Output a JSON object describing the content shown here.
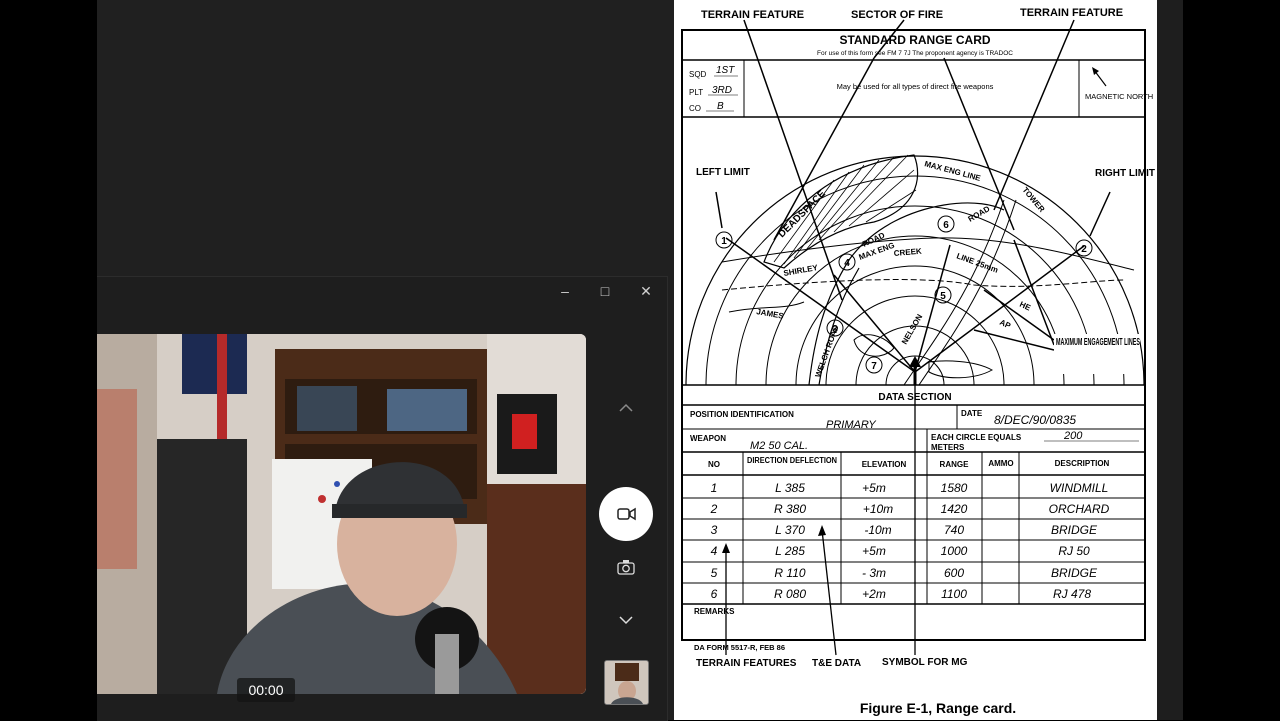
{
  "camera_app": {
    "timer": "00:00",
    "controls": {
      "up_icon": "chevron-up-icon",
      "down_icon": "chevron-down-icon",
      "video_icon": "video-camera-icon",
      "photo_icon": "camera-icon"
    }
  },
  "doc": {
    "top_labels": {
      "left": "TERRAIN FEATURE",
      "center": "SECTOR OF FIRE",
      "right": "TERRAIN FEATURE"
    },
    "title": "STANDARD RANGE CARD",
    "subtitle": "For use of this form see FM 7 7J  The proponent agency is TRADOC",
    "unit_labels": {
      "sqd": "SQD",
      "plt": "PLT",
      "co": "CO"
    },
    "unit_values": {
      "sqd": "1ST",
      "plt": "3RD",
      "co": "B"
    },
    "weapons_note": "May be used for all types of direct fire weapons",
    "north": "MAGNETIC NORTH",
    "left_limit": "LEFT LIMIT",
    "right_limit": "RIGHT LIMIT",
    "max_engagement": "MAXIMUM ENGAGEMENT LINES",
    "sketch": {
      "deadspace": "DEADSPACE",
      "max_eng_line": "MAX ENG LINE",
      "road": "ROAD",
      "max_eng": "MAX ENG",
      "shirley": "SHIRLEY",
      "line_25mm": "LINE 25mm",
      "creek": "CREEK",
      "james": "JAMES",
      "nelson": "NELSON",
      "welch_road": "WELCH ROAD",
      "he": "HE",
      "ap": "AP",
      "tower": "TOWER"
    },
    "data_section_title": "DATA SECTION",
    "position_label": "POSITION IDENTIFICATION",
    "position_value": "PRIMARY",
    "date_label": "DATE",
    "date_value": "8/DEC/90/0835",
    "weapon_label": "WEAPON",
    "weapon_value": "M2 50 CAL.",
    "circle_label": "EACH CIRCLE EQUALS",
    "circle_unit": "METERS",
    "circle_value": "200",
    "table_headers": [
      "NO",
      "DIRECTION DEFLECTION",
      "ELEVATION",
      "RANGE",
      "AMMO",
      "DESCRIPTION"
    ],
    "rows": [
      {
        "no": "1",
        "dir": "L 385",
        "elev": "+5m",
        "range": "1580",
        "desc": "WINDMILL"
      },
      {
        "no": "2",
        "dir": "R 380",
        "elev": "+10m",
        "range": "1420",
        "desc": "ORCHARD"
      },
      {
        "no": "3",
        "dir": "L 370",
        "elev": "-10m",
        "range": "740",
        "desc": "BRIDGE"
      },
      {
        "no": "4",
        "dir": "L 285",
        "elev": "+5m",
        "range": "1000",
        "desc": "RJ 50"
      },
      {
        "no": "5",
        "dir": "R 110",
        "elev": "- 3m",
        "range": "600",
        "desc": "BRIDGE"
      },
      {
        "no": "6",
        "dir": "R 080",
        "elev": "+2m",
        "range": "1100",
        "desc": "RJ 478"
      }
    ],
    "remarks": "REMARKS",
    "form_no": "DA FORM 5517-R, FEB 86",
    "bottom_labels": {
      "terrain": "TERRAIN FEATURES",
      "te": "T&E DATA",
      "mg": "SYMBOL FOR MG"
    },
    "caption": "Figure E-1, Range card."
  }
}
